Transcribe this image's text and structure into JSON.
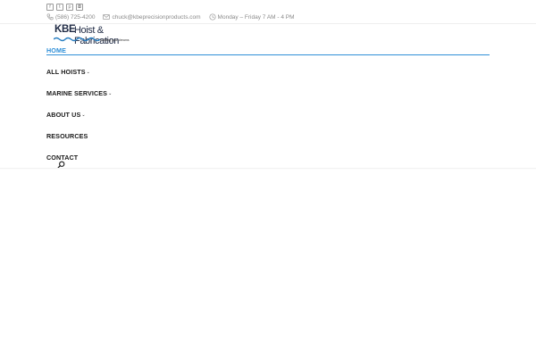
{
  "social": {
    "icons": [
      "facebook-icon",
      "twitter-icon",
      "pinterest-icon",
      "instagram-icon"
    ],
    "glyphs": [
      "f",
      "t",
      "p",
      "◘"
    ]
  },
  "contact": {
    "phone": "(586) 725-4200",
    "email": "chuck@kbeprecisionproducts.com",
    "hours": "Monday – Friday 7 AM - 4 PM"
  },
  "logo": {
    "brand": "KBE",
    "name": "Hoist & Fabrication",
    "tagline": "building your dreams"
  },
  "nav": {
    "items": [
      {
        "label": "HOME",
        "active": true,
        "has_submenu": false
      },
      {
        "label": "ALL HOISTS",
        "active": false,
        "has_submenu": true
      },
      {
        "label": "MARINE SERVICES",
        "active": false,
        "has_submenu": true
      },
      {
        "label": "ABOUT US",
        "active": false,
        "has_submenu": true
      },
      {
        "label": "RESOURCES",
        "active": false,
        "has_submenu": false
      },
      {
        "label": "CONTACT",
        "active": false,
        "has_submenu": false
      }
    ],
    "chevron": "⌄"
  },
  "colors": {
    "accent": "#2e8fd8",
    "nav_text": "#1a1a1a",
    "muted": "#8a8a8a",
    "brand_navy": "#1f2a44",
    "wave_blue": "#2a7fc1"
  }
}
